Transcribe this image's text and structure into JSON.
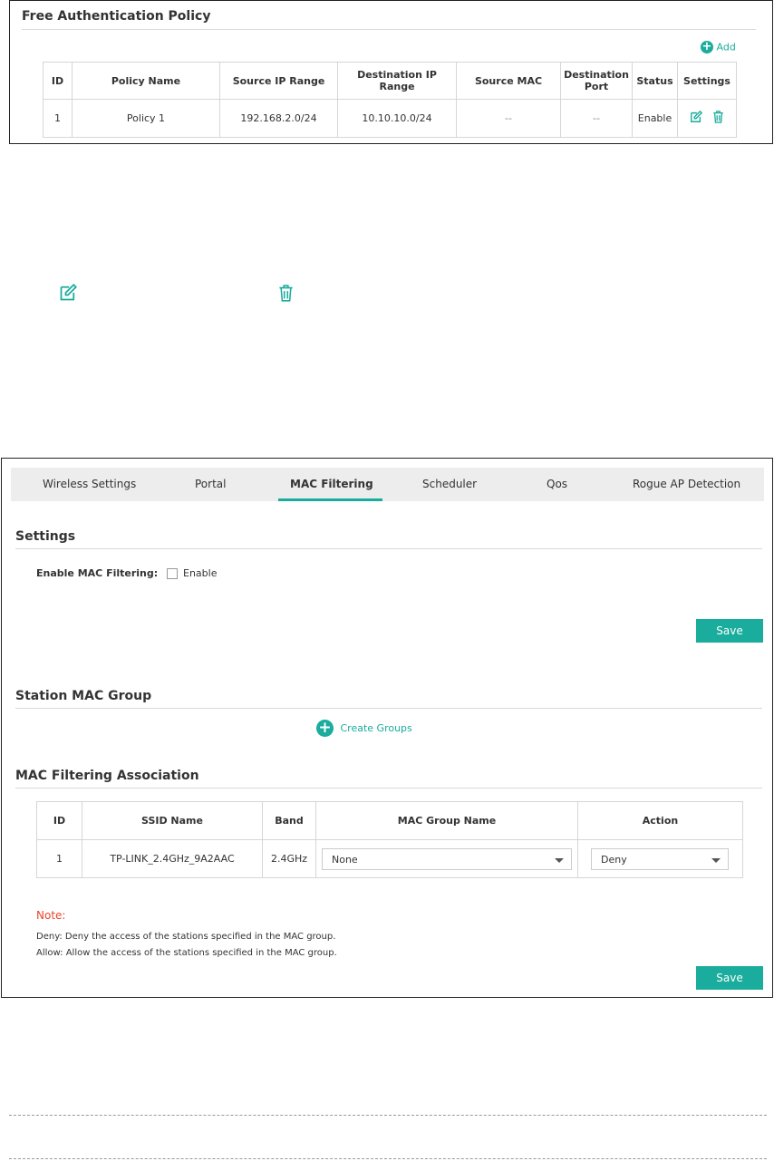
{
  "policy": {
    "title": "Free Authentication Policy",
    "add_label": "Add",
    "columns": [
      "ID",
      "Policy Name",
      "Source IP Range",
      "Destination IP Range",
      "Source MAC",
      "Destination\nPort",
      "Status",
      "Settings"
    ],
    "rows": [
      {
        "id": "1",
        "name": "Policy 1",
        "src_ip": "192.168.2.0/24",
        "dst_ip": "10.10.10.0/24",
        "src_mac": "--",
        "dst_port": "--",
        "status": "Enable"
      }
    ]
  },
  "mac": {
    "tabs": [
      "Wireless Settings",
      "Portal",
      "MAC Filtering",
      "Scheduler",
      "Qos",
      "Rogue AP Detection"
    ],
    "active_tab": "MAC Filtering",
    "settings_title": "Settings",
    "enable_label": "Enable MAC Filtering:",
    "enable_checkbox_label": "Enable",
    "save_label": "Save",
    "group_title": "Station MAC Group",
    "create_groups_label": "Create Groups",
    "assoc_title": "MAC Filtering Association",
    "assoc_columns": [
      "ID",
      "SSID Name",
      "Band",
      "MAC Group Name",
      "Action"
    ],
    "assoc_rows": [
      {
        "id": "1",
        "ssid": "TP-LINK_2.4GHz_9A2AAC",
        "band": "2.4GHz",
        "group": "None",
        "action": "Deny"
      }
    ],
    "note_title": "Note:",
    "note_lines": [
      "Deny: Deny the access of the stations specified in the MAC group.",
      "Allow: Allow the access of the stations specified in the MAC group."
    ]
  },
  "colors": {
    "accent": "#1aac9c",
    "note": "#e8442b",
    "tab_bar": "#ededed"
  }
}
